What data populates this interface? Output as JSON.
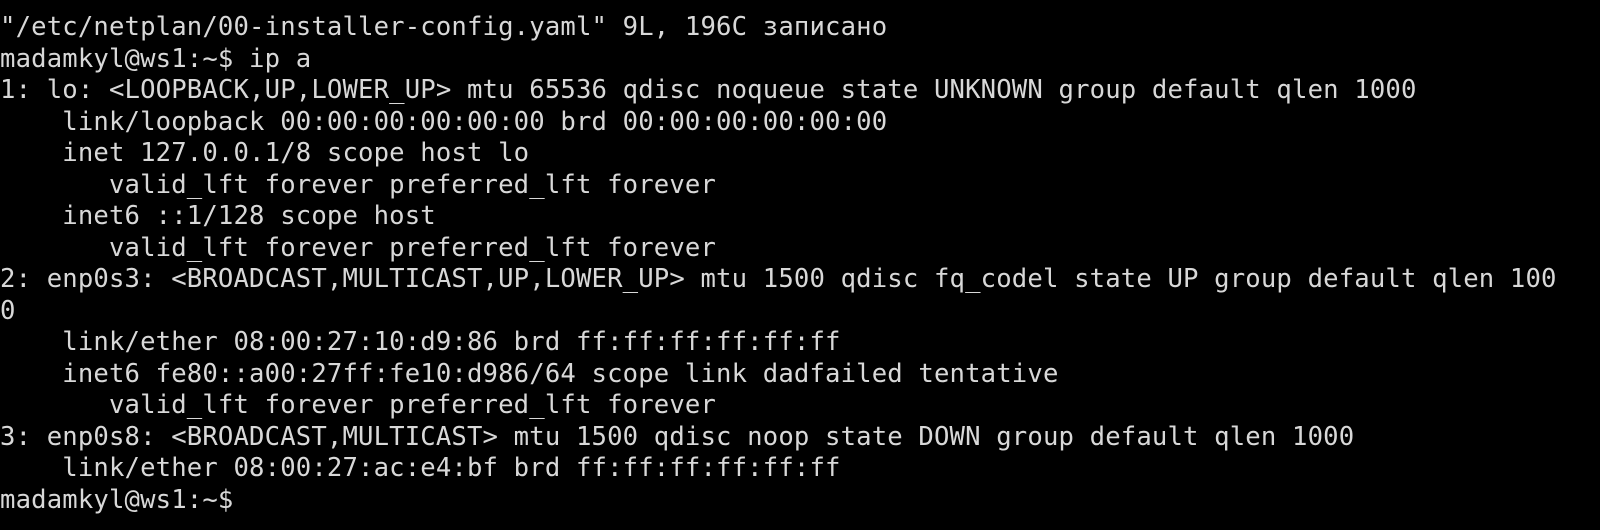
{
  "terminal": {
    "foreground": "#d8d8d8",
    "background": "#000000",
    "lines": [
      "\"/etc/netplan/00-installer-config.yaml\" 9L, 196C записано",
      "madamkyl@ws1:~$ ip a",
      "1: lo: <LOOPBACK,UP,LOWER_UP> mtu 65536 qdisc noqueue state UNKNOWN group default qlen 1000",
      "    link/loopback 00:00:00:00:00:00 brd 00:00:00:00:00:00",
      "    inet 127.0.0.1/8 scope host lo",
      "       valid_lft forever preferred_lft forever",
      "    inet6 ::1/128 scope host",
      "       valid_lft forever preferred_lft forever",
      "2: enp0s3: <BROADCAST,MULTICAST,UP,LOWER_UP> mtu 1500 qdisc fq_codel state UP group default qlen 100",
      "0",
      "    link/ether 08:00:27:10:d9:86 brd ff:ff:ff:ff:ff:ff",
      "    inet6 fe80::a00:27ff:fe10:d986/64 scope link dadfailed tentative",
      "       valid_lft forever preferred_lft forever",
      "3: enp0s8: <BROADCAST,MULTICAST> mtu 1500 qdisc noop state DOWN group default qlen 1000",
      "    link/ether 08:00:27:ac:e4:bf brd ff:ff:ff:ff:ff:ff"
    ],
    "prompt": "madamkyl@ws1:~$"
  }
}
